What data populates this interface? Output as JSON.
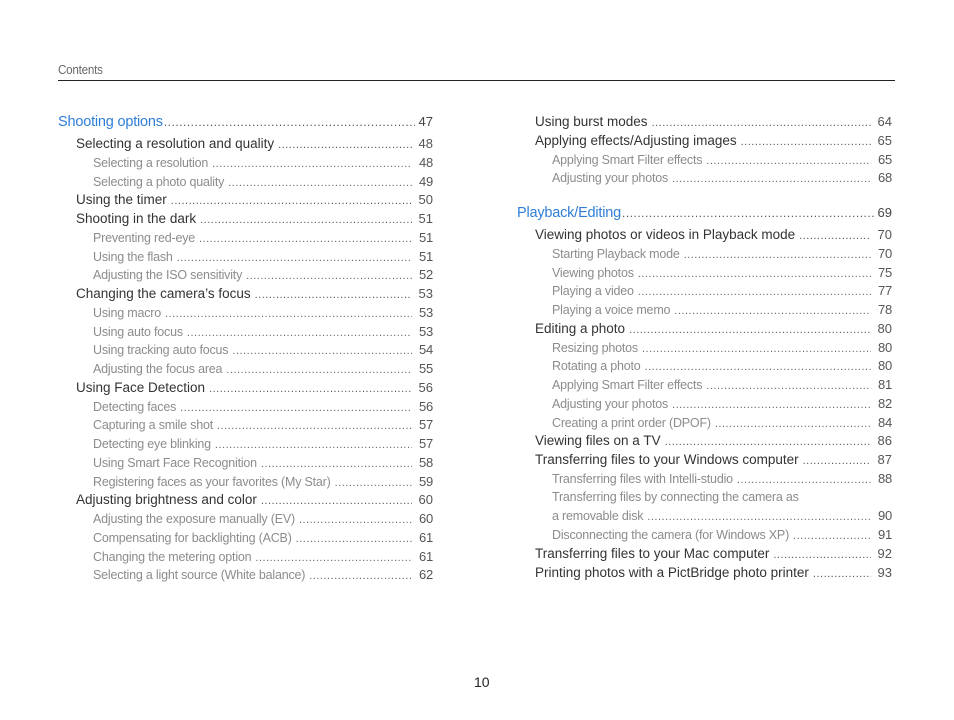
{
  "header": {
    "title": "Contents"
  },
  "colors": {
    "section_heading": "#2f7ed8",
    "rule": "#222222"
  },
  "left_column": [
    {
      "level": 0,
      "label": "Shooting options",
      "page": "47"
    },
    {
      "level": 1,
      "label": "Selecting a resolution and quality",
      "page": "48"
    },
    {
      "level": 2,
      "label": "Selecting a resolution",
      "page": "48"
    },
    {
      "level": 2,
      "label": "Selecting a photo quality",
      "page": "49"
    },
    {
      "level": 1,
      "label": "Using the timer",
      "page": "50"
    },
    {
      "level": 1,
      "label": "Shooting in the dark",
      "page": "51"
    },
    {
      "level": 2,
      "label": "Preventing red-eye",
      "page": "51"
    },
    {
      "level": 2,
      "label": "Using the flash",
      "page": "51"
    },
    {
      "level": 2,
      "label": "Adjusting the ISO sensitivity",
      "page": "52"
    },
    {
      "level": 1,
      "label": "Changing the camera’s focus",
      "page": "53"
    },
    {
      "level": 2,
      "label": "Using macro",
      "page": "53"
    },
    {
      "level": 2,
      "label": "Using auto focus",
      "page": "53"
    },
    {
      "level": 2,
      "label": "Using tracking auto focus",
      "page": "54"
    },
    {
      "level": 2,
      "label": "Adjusting the focus area",
      "page": "55"
    },
    {
      "level": 1,
      "label": "Using Face Detection",
      "page": "56"
    },
    {
      "level": 2,
      "label": "Detecting faces",
      "page": "56"
    },
    {
      "level": 2,
      "label": "Capturing a smile shot",
      "page": "57"
    },
    {
      "level": 2,
      "label": "Detecting eye blinking",
      "page": "57"
    },
    {
      "level": 2,
      "label": "Using Smart Face Recognition",
      "page": "58"
    },
    {
      "level": 2,
      "label": "Registering faces as your favorites (My Star)",
      "page": "59"
    },
    {
      "level": 1,
      "label": "Adjusting brightness and color",
      "page": "60"
    },
    {
      "level": 2,
      "label": "Adjusting the exposure manually (EV)",
      "page": "60"
    },
    {
      "level": 2,
      "label": "Compensating for backlighting (ACB)",
      "page": "61"
    },
    {
      "level": 2,
      "label": "Changing the metering option",
      "page": "61"
    },
    {
      "level": 2,
      "label": "Selecting a light source (White balance)",
      "page": "62"
    }
  ],
  "right_column": [
    {
      "level": 1,
      "label": "Using burst modes",
      "page": "64"
    },
    {
      "level": 1,
      "label": "Applying effects/Adjusting images",
      "page": "65"
    },
    {
      "level": 2,
      "label": "Applying Smart Filter effects",
      "page": "65"
    },
    {
      "level": 2,
      "label": "Adjusting your photos",
      "page": "68"
    },
    {
      "level": "spacer"
    },
    {
      "level": 0,
      "label": "Playback/Editing",
      "page": "69"
    },
    {
      "level": 1,
      "label": "Viewing photos or videos in Playback mode",
      "page": "70"
    },
    {
      "level": 2,
      "label": "Starting Playback mode",
      "page": "70"
    },
    {
      "level": 2,
      "label": "Viewing photos",
      "page": "75"
    },
    {
      "level": 2,
      "label": "Playing a video",
      "page": "77"
    },
    {
      "level": 2,
      "label": "Playing a voice memo",
      "page": "78"
    },
    {
      "level": 1,
      "label": "Editing a photo",
      "page": "80"
    },
    {
      "level": 2,
      "label": "Resizing photos",
      "page": "80"
    },
    {
      "level": 2,
      "label": "Rotating a photo",
      "page": "80"
    },
    {
      "level": 2,
      "label": "Applying Smart Filter effects",
      "page": "81"
    },
    {
      "level": 2,
      "label": "Adjusting your photos",
      "page": "82"
    },
    {
      "level": 2,
      "label": "Creating a print order (DPOF)",
      "page": "84"
    },
    {
      "level": 1,
      "label": "Viewing files on a TV",
      "page": "86"
    },
    {
      "level": 1,
      "label": "Transferring files to your Windows computer",
      "page": "87"
    },
    {
      "level": 2,
      "label": "Transferring files with Intelli-studio",
      "page": "88"
    },
    {
      "level": 2,
      "label": "Transferring files by connecting the camera as",
      "continuation": "a removable disk",
      "page": "90"
    },
    {
      "level": 2,
      "label": "Disconnecting the camera (for Windows XP)",
      "page": "91"
    },
    {
      "level": 1,
      "label": "Transferring files to your Mac computer",
      "page": "92"
    },
    {
      "level": 1,
      "label": "Printing photos with a PictBridge photo printer",
      "page": "93"
    }
  ],
  "footer": {
    "page_number": "10"
  }
}
